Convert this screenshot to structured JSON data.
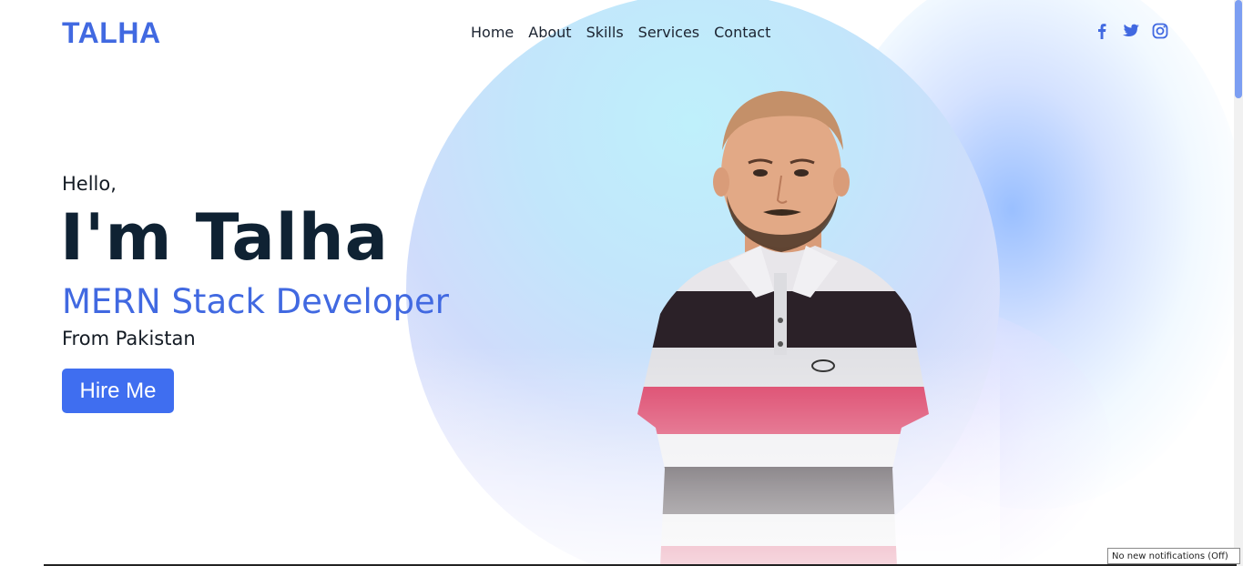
{
  "header": {
    "logo": "TALHA",
    "nav": [
      "Home",
      "About",
      "Skills",
      "Services",
      "Contact"
    ],
    "social_icons": [
      "facebook-icon",
      "twitter-icon",
      "instagram-icon"
    ]
  },
  "hero": {
    "greeting": "Hello,",
    "name": "I'm Talha",
    "role": "MERN Stack Developer",
    "origin": "From Pakistan",
    "cta_label": "Hire Me"
  },
  "status": {
    "notification": "No new notifications (Off)"
  },
  "colors": {
    "accent": "#4169e1",
    "button": "#3f6ef0",
    "heading": "#0f2233"
  }
}
